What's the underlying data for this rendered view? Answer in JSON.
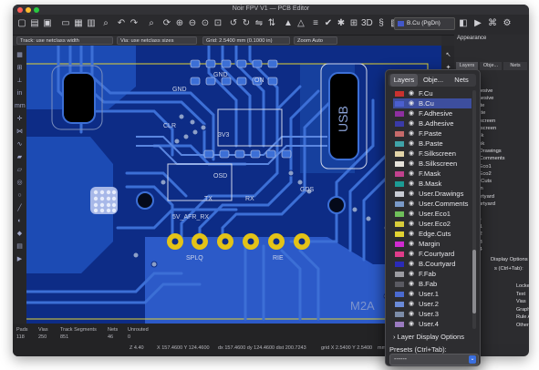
{
  "window": {
    "title": "Noir FPV V1 — PCB Editor",
    "traffic_lights": [
      "#ff5f57",
      "#febc2e",
      "#28c840"
    ]
  },
  "toolbar": {
    "icons": [
      "new-board-icon",
      "open-icon",
      "save-icon",
      "page-settings-icon",
      "print-icon",
      "plot-icon",
      "undo-icon",
      "redo-icon",
      "refresh-icon",
      "zoom-in-icon",
      "zoom-out-icon",
      "zoom-fit-icon",
      "zoom-area-icon",
      "rotate-ccw-icon",
      "rotate-cw-icon",
      "flip-icon",
      "lock-icon",
      "unlock-icon",
      "netlist-icon",
      "drc-icon",
      "3d-viewer-icon",
      "script-icon"
    ],
    "active_layer": "B.Cu (PgDn)",
    "active_layer_color": "#4257c9"
  },
  "options": {
    "track": "Track: use netclass width",
    "via": "Via: use netclass sizes",
    "grid": "Grid: 2.5400 mm (0.1000 in)",
    "zoom": "Zoom Auto"
  },
  "board": {
    "silkscreen": [
      "USB",
      "M2A",
      "CLR",
      "TX",
      "RX",
      "GND",
      "5V",
      "ON",
      "3V3",
      "GDS",
      "OSD",
      "5V_AFR_RX",
      "SPLQ",
      "RIE"
    ],
    "colors": {
      "background": "#0d2c86",
      "copper": "#3c6fd6",
      "copper_dark": "#1c4bb4",
      "pad": "#e3c317",
      "via": "#8da0c8",
      "silk": "#cfd6ea"
    }
  },
  "status": {
    "headers": [
      "Pads",
      "Vias",
      "Track Segments",
      "Nets",
      "Unrouted"
    ],
    "values": [
      "118",
      "250",
      "851",
      "46",
      "0"
    ],
    "coords": [
      "Z 4.40",
      "X 157.4600 Y 124.4600",
      "dx 157.4600 dy 124.4600 dist 200.7243",
      "grid X 2.5400 Y 2.5400",
      "mm"
    ]
  },
  "appearance": {
    "title": "Appearance",
    "tabs": [
      "Layers",
      "Obje...",
      "Nets"
    ],
    "layers": [
      "F.Cu",
      "B.Cu",
      "F.Adhesive",
      "B.Adhesive",
      "F.Paste",
      "B.Paste",
      "F.Silkscreen",
      "B.Silkscreen",
      "F.Mask",
      "B.Mask",
      "User.Drawings",
      "User.Comments",
      "User.Eco1",
      "User.Eco2",
      "Edge.Cuts",
      "Margin",
      "F.Courtyard",
      "B.Courtyard",
      "F.Fab",
      "B.Fab",
      "User.1",
      "User.2",
      "User.3",
      "User.4"
    ],
    "display_options": "Display Options",
    "presets": "s (Ctrl+Tab):",
    "checkboxes": [
      "Locked I",
      "Text",
      "Vias",
      "Graphics",
      "Rule Are",
      "Other It"
    ]
  },
  "popup": {
    "tabs": [
      "Layers",
      "Obje...",
      "Nets"
    ],
    "layers": [
      {
        "name": "F.Cu",
        "color": "#c8322f"
      },
      {
        "name": "B.Cu",
        "color": "#4b5fcf",
        "selected": true
      },
      {
        "name": "F.Adhesive",
        "color": "#8e2fa0"
      },
      {
        "name": "B.Adhesive",
        "color": "#3a3aa8"
      },
      {
        "name": "F.Paste",
        "color": "#c76a6a"
      },
      {
        "name": "B.Paste",
        "color": "#3fa3a8"
      },
      {
        "name": "F.Silkscreen",
        "color": "#e3d5a8"
      },
      {
        "name": "B.Silkscreen",
        "color": "#e6e3dc"
      },
      {
        "name": "F.Mask",
        "color": "#c2428e"
      },
      {
        "name": "B.Mask",
        "color": "#1c9c94"
      },
      {
        "name": "User.Drawings",
        "color": "#c9ccd4"
      },
      {
        "name": "User.Comments",
        "color": "#7a9ac8"
      },
      {
        "name": "User.Eco1",
        "color": "#6fbf5a"
      },
      {
        "name": "User.Eco2",
        "color": "#d8cc3a"
      },
      {
        "name": "Edge.Cuts",
        "color": "#e2d332"
      },
      {
        "name": "Margin",
        "color": "#d02ad0"
      },
      {
        "name": "F.Courtyard",
        "color": "#e03c8a"
      },
      {
        "name": "B.Courtyard",
        "color": "#2a2ab8"
      },
      {
        "name": "F.Fab",
        "color": "#9c9ca2"
      },
      {
        "name": "B.Fab",
        "color": "#5a5a62"
      },
      {
        "name": "User.1",
        "color": "#4a6ad0"
      },
      {
        "name": "User.2",
        "color": "#6a8ad8"
      },
      {
        "name": "User.3",
        "color": "#7c8ca8"
      },
      {
        "name": "User.4",
        "color": "#9a7ac0"
      }
    ],
    "layer_display_options": "Layer Display Options",
    "presets_label": "Presets (Ctrl+Tab):",
    "presets_value": "------"
  }
}
